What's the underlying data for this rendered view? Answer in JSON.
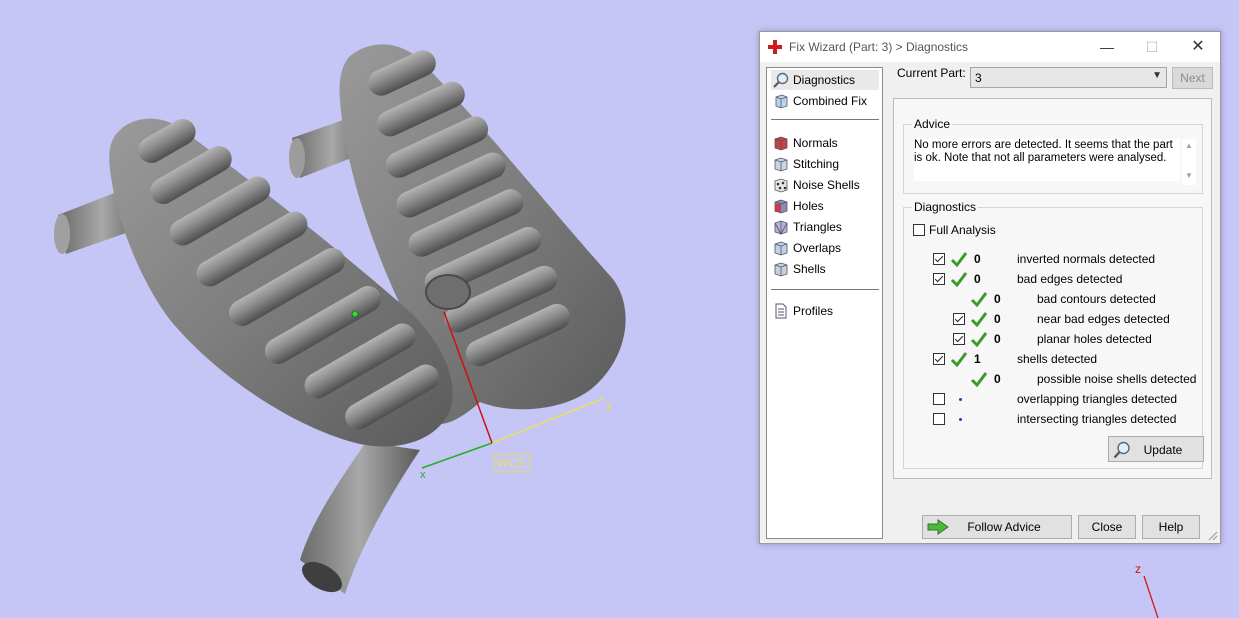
{
  "viewport": {
    "background": "#c5c5f6",
    "axis_labels": {
      "x": "x",
      "y": "y",
      "z": "z"
    },
    "wcs_label": "WCS"
  },
  "window": {
    "title": "Fix Wizard (Part: 3) > Diagnostics",
    "icon": "red-cross-icon",
    "controls": {
      "minimize": "—",
      "maximize": "☐",
      "close": "✕"
    }
  },
  "sidebar": {
    "items": [
      {
        "label": "Diagnostics",
        "icon": "magnifier-icon",
        "selected": true
      },
      {
        "label": "Combined Fix",
        "icon": "cube-icon"
      },
      {
        "label": "Normals",
        "icon": "normals-icon"
      },
      {
        "label": "Stitching",
        "icon": "stitching-icon"
      },
      {
        "label": "Noise Shells",
        "icon": "noise-shells-icon"
      },
      {
        "label": "Holes",
        "icon": "holes-icon"
      },
      {
        "label": "Triangles",
        "icon": "triangles-icon"
      },
      {
        "label": "Overlaps",
        "icon": "overlaps-icon"
      },
      {
        "label": "Shells",
        "icon": "shells-icon"
      },
      {
        "label": "Profiles",
        "icon": "document-icon"
      }
    ]
  },
  "current_part": {
    "label": "Current Part:",
    "value": "3"
  },
  "next_button": "Next",
  "advice": {
    "title": "Advice",
    "text": "No more errors are detected. It seems that the part is ok. Note that not all parameters were analysed."
  },
  "diagnostics": {
    "title": "Diagnostics",
    "full_analysis": {
      "label": "Full Analysis",
      "checked": false
    },
    "rows": [
      {
        "checked": true,
        "count": "0",
        "label": "inverted normals detected",
        "status": "ok"
      },
      {
        "checked": true,
        "count": "0",
        "label": "bad edges detected",
        "status": "ok"
      },
      {
        "count": "0",
        "label": "bad contours detected",
        "status": "ok"
      },
      {
        "checked": true,
        "count": "0",
        "label": "near bad edges detected",
        "status": "ok"
      },
      {
        "checked": true,
        "count": "0",
        "label": "planar holes detected",
        "status": "ok"
      },
      {
        "checked": true,
        "count": "1",
        "label": "shells detected",
        "status": "ok"
      },
      {
        "count": "0",
        "label": "possible noise shells detected",
        "status": "ok"
      },
      {
        "checked": false,
        "count": "",
        "label": "overlapping triangles detected",
        "status": "none"
      },
      {
        "checked": false,
        "count": "",
        "label": "intersecting triangles detected",
        "status": "none"
      }
    ],
    "update_button": "Update"
  },
  "footer": {
    "follow_advice": "Follow Advice",
    "close": "Close",
    "help": "Help"
  },
  "colors": {
    "tick_green": "#3c9a2c",
    "dot_blue": "#1a40c0",
    "x_axis": "#22b022",
    "y_axis": "#e8e05a",
    "z_axis": "#d01010"
  }
}
